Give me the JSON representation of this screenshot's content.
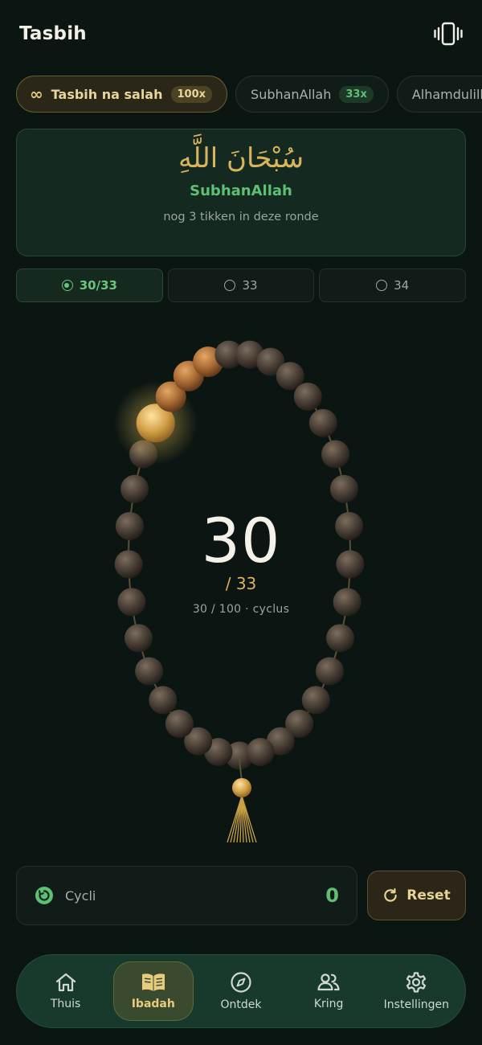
{
  "header": {
    "title": "Tasbih",
    "vibrate_icon": "vibrate-icon"
  },
  "chips": [
    {
      "label": "Tasbih na salah",
      "badge": "100x",
      "icon": "infinity-icon",
      "active": true
    },
    {
      "label": "SubhanAllah",
      "badge": "33x",
      "active": false
    },
    {
      "label": "Alhamdulillah",
      "badge": "",
      "active": false
    }
  ],
  "dhikr": {
    "arabic": "سُبْحَانَ اللَّهِ",
    "transliteration": "SubhanAllah",
    "remaining": "nog 3 tikken in deze ronde"
  },
  "targets": [
    {
      "label": "30/33",
      "selected": true
    },
    {
      "label": "33",
      "selected": false
    },
    {
      "label": "34",
      "selected": false
    }
  ],
  "counter": {
    "count": "30",
    "target": "/ 33",
    "cycle": "30 / 100 · cyclus",
    "count_value": 30,
    "target_value": 33
  },
  "cycli": {
    "label": "Cycli",
    "value": "0",
    "icon": "cycle-icon"
  },
  "reset": {
    "label": "Reset",
    "icon": "refresh-icon"
  },
  "nav": [
    {
      "label": "Thuis",
      "icon": "home-icon",
      "active": false
    },
    {
      "label": "Ibadah",
      "icon": "book-icon",
      "active": true
    },
    {
      "label": "Ontdek",
      "icon": "compass-icon",
      "active": false
    },
    {
      "label": "Kring",
      "icon": "people-icon",
      "active": false
    },
    {
      "label": "Instellingen",
      "icon": "gear-icon",
      "active": false
    }
  ],
  "colors": {
    "background": "#0b1512",
    "accent_green": "#5fbf74",
    "accent_gold": "#d9b45c",
    "bead_dark": "#4a4036",
    "bead_gold": "#d4a24a"
  }
}
